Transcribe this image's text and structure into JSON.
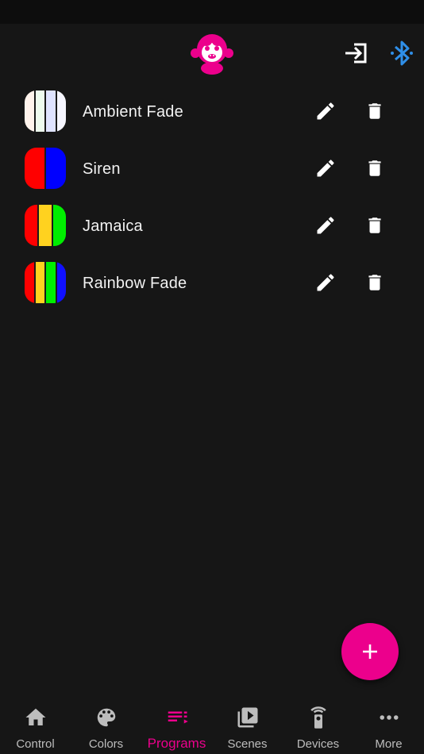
{
  "colors": {
    "accent": "#ec008c",
    "background": "#161616",
    "bluetooth": "#2f8fe8",
    "nav_inactive": "#bdbdbd"
  },
  "header": {
    "logo_icon": "monkey-logo-icon",
    "login_icon": "login-icon",
    "bluetooth_icon": "bluetooth-icon"
  },
  "programs": [
    {
      "name": "Ambient Fade",
      "stripes": [
        "#fff3ec",
        "#eefbee",
        "#dfe3ff",
        "#f6f6ff"
      ]
    },
    {
      "name": "Siren",
      "stripes": [
        "#ff0000",
        "#0000ff"
      ]
    },
    {
      "name": "Jamaica",
      "stripes": [
        "#ff0000",
        "#ffd21f",
        "#00ee00"
      ]
    },
    {
      "name": "Rainbow Fade",
      "stripes": [
        "#ff0000",
        "#ffd21f",
        "#00ee00",
        "#1010ff"
      ]
    }
  ],
  "fab": {
    "icon": "plus-icon"
  },
  "nav": {
    "items": [
      {
        "label": "Control",
        "icon": "home-icon",
        "active": false
      },
      {
        "label": "Colors",
        "icon": "palette-icon",
        "active": false
      },
      {
        "label": "Programs",
        "icon": "playlist-icon",
        "active": true
      },
      {
        "label": "Scenes",
        "icon": "video-library-icon",
        "active": false
      },
      {
        "label": "Devices",
        "icon": "remote-icon",
        "active": false
      },
      {
        "label": "More",
        "icon": "more-icon",
        "active": false
      }
    ]
  }
}
